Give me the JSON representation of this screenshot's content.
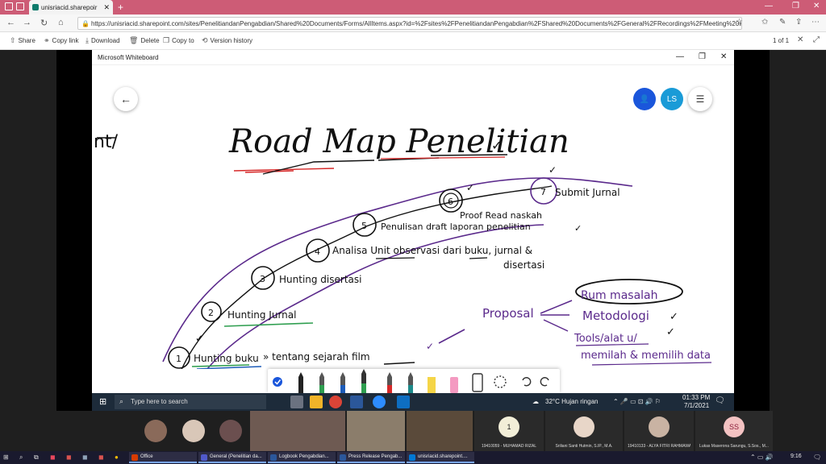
{
  "browser": {
    "tab_title": "unisriacid.sharepoir",
    "url": "https://unisriacid.sharepoint.com/sites/PenelitiandanPengabdian/Shared%20Documents/Forms/AllItems.aspx?id=%2Fsites%2FPenelitiandanPengabdian%2FShared%20Documents%2FGeneral%2FRecordings%2FMeeting%20in%20%5FGeneral%5F%2D20210..."
  },
  "toolbar": {
    "share": "Share",
    "copy_link": "Copy link",
    "download": "Download",
    "delete": "Delete",
    "copy_to": "Copy to",
    "version_history": "Version history",
    "page_count": "1 of 1"
  },
  "whiteboard": {
    "title": "Microsoft Whiteboard",
    "avatar_ls": "LS",
    "heading": "Road Map Penelitian",
    "partial_left": "nt/",
    "steps": [
      {
        "num": "1",
        "text": "Hunting buku"
      },
      {
        "num": "2",
        "text": "Hunting Jurnal"
      },
      {
        "num": "3",
        "text": "Hunting disertasi"
      },
      {
        "num": "4",
        "text": "Analisa Unit observasi dari buku, jurnal &"
      },
      {
        "num": "5",
        "text": "Penulisan draft laporan penelitian"
      },
      {
        "num": "6",
        "text": "Proof Read naskah"
      },
      {
        "num": "7",
        "text": "Submit Jurnal"
      }
    ],
    "step1_suffix": "» tentang sejarah film",
    "step4_cont": "disertasi",
    "proposal": "Proposal",
    "proposal_items": [
      "Rum masalah",
      "Metodologi",
      "Tools/alat u/",
      "memilah & memilih data"
    ]
  },
  "inner_taskbar": {
    "search": "Type here to search",
    "weather": "32°C  Hujan ringan",
    "time": "01:33 PM",
    "date": "7/1/2021"
  },
  "participants": {
    "count_badge": "1",
    "names": [
      "19410059 - MUHAMAD RIZAL",
      "Sriliani Santi Hutmin, S.IP., M.A.",
      "19410133 - ALYA FITRI RAHMAWATI",
      "Lukas Maserona Sarungu, S.Sos., M..."
    ],
    "initials_ss": "SS"
  },
  "os_taskbar": {
    "office": "Office",
    "apps": [
      "General (Penelitian da...",
      "Logbook Pengabdian...",
      "Press Release Pengab...",
      "unisriacid.sharepoint...."
    ],
    "time": "9:16"
  },
  "colors": {
    "tabbar": "#cd5c76",
    "accent_blue": "#1a56db",
    "avatar_ls": "#1a9bd7",
    "ink_purple": "#5b2a8c",
    "ink_red": "#d62828",
    "ink_green": "#2e9e4f",
    "ink_blue": "#1c5bb8"
  }
}
